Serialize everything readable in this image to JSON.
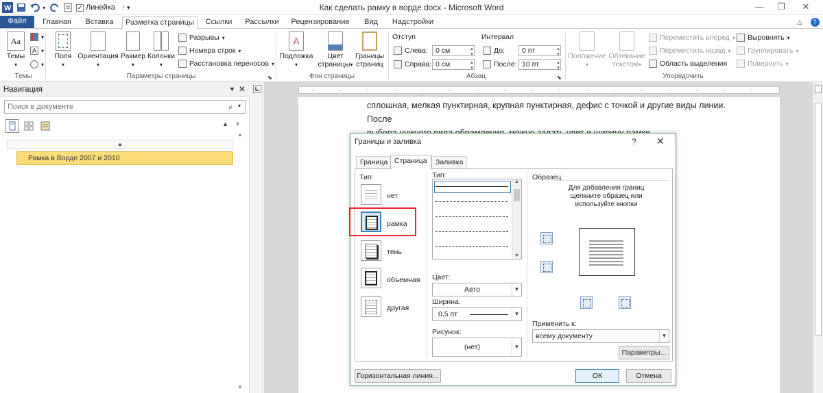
{
  "window": {
    "title": "Как сделать рамку в ворде.docx  -  Microsoft Word",
    "qat_ruler_label": "Линейка"
  },
  "tabs": [
    "Файл",
    "Главная",
    "Вставка",
    "Разметка страницы",
    "Ссылки",
    "Рассылки",
    "Рецензирование",
    "Вид",
    "Надстройки"
  ],
  "ribbon": {
    "themes": {
      "button": "Темы",
      "group": "Темы"
    },
    "page_setup": {
      "fields": "Поля",
      "orientation": "Ориентация",
      "size": "Размер",
      "columns": "Колонки",
      "breaks": "Разрывы",
      "line_numbers": "Номера строк",
      "hyphenation": "Расстановка переносов",
      "group": "Параметры страницы"
    },
    "page_background": {
      "watermark": "Подложка",
      "page_color_1": "Цвет",
      "page_color_2": "страницы",
      "page_borders_1": "Границы",
      "page_borders_2": "страниц",
      "group": "Фон страницы"
    },
    "paragraph": {
      "indent": "Отступ",
      "left_label": "Слева:",
      "left_value": "0 см",
      "right_label": "Справа:",
      "right_value": "0 см",
      "spacing": "Интервал",
      "before_label": "До:",
      "before_value": "0 пт",
      "after_label": "После:",
      "after_value": "10 пт",
      "group": "Абзац"
    },
    "arrange": {
      "position_1": "Положение",
      "wrap_1": "Обтекание",
      "wrap_2": "текстом",
      "bring_forward": "Переместить вперед",
      "send_backward": "Переместить назад",
      "selection_pane": "Область выделения",
      "align": "Выровнять",
      "group_btn": "Группировать",
      "rotate": "Повернуть",
      "group": "Упорядочить"
    }
  },
  "navigation": {
    "title": "Навигация",
    "search_placeholder": "Поиск в документе",
    "heading_item": "Рамка в Ворде 2007 и 2010"
  },
  "document": {
    "line1": "сплошная, мелкая пунктирная, крупная пунктирная, дефис с точкой и другие виды линии. После",
    "line2": "выбора нужного вида обрамления, можно задать цвет и ширину рамке."
  },
  "dialog": {
    "title": "Границы и заливка",
    "help": "?",
    "close": "✕",
    "tabs": [
      "Граница",
      "Страница",
      "Заливка"
    ],
    "setting_label": "Тип:",
    "settings": [
      "нет",
      "рамка",
      "тень",
      "объемная",
      "другая"
    ],
    "style_label": "Тип:",
    "color_label": "Цвет:",
    "color_value": "Авто",
    "width_label": "Ширина:",
    "width_value": "0,5 пт",
    "art_label": "Рисунок:",
    "art_value": "(нет)",
    "preview_label": "Образец",
    "preview_hint": "Для добавления границ щелкните образец или используйте кнопки",
    "apply_label": "Применить к:",
    "apply_value": "всему документу",
    "options_btn": "Параметры...",
    "horizontal_line_btn": "Горизонтальная линия...",
    "ok_btn": "ОК",
    "cancel_btn": "Отмена"
  },
  "colors": {
    "file_tab": "#2b5797",
    "nav_highlight": "#fddc7a",
    "annotation_red": "#e8212a"
  }
}
